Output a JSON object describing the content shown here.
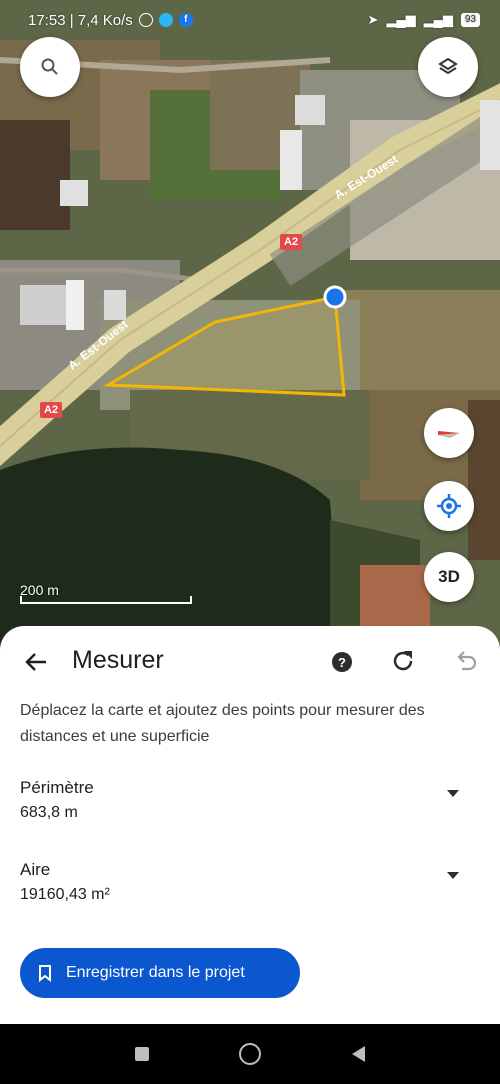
{
  "status_bar": {
    "time_speed": "17:53 | 7,4 Ko/s",
    "battery": "93"
  },
  "map": {
    "road_label_1": "A. Est-Ouest",
    "road_label_2": "A. Est-Ouest",
    "shield_1": "A2",
    "shield_2": "A2",
    "scale_label": "200 m",
    "threed_label": "3D"
  },
  "sheet": {
    "title": "Mesurer",
    "description": "Déplacez la carte et ajoutez des points pour mesurer des distances et une superficie",
    "perimeter_label": "Périmètre",
    "perimeter_value": "683,8 m",
    "area_label": "Aire",
    "area_value": "19160,43 m²",
    "save_label": "Enregistrer dans le projet"
  },
  "colors": {
    "accent": "#0b57d0",
    "polygon": "#f2b705",
    "point": "#1a73e8"
  }
}
